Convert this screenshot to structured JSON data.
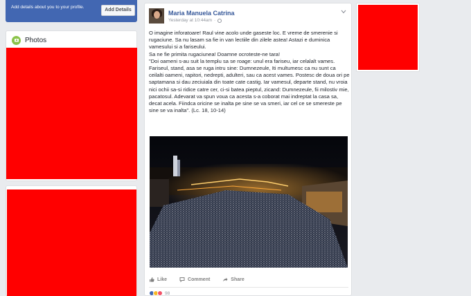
{
  "profile_prompt": {
    "text": "Add details about you to your profile.",
    "button_label": "Add Details"
  },
  "photos": {
    "title": "Photos",
    "icon": "photos-icon"
  },
  "post": {
    "author": "Maria Manuela Catrina",
    "timestamp": "Yesterday at 10:44am",
    "separator": "·",
    "privacy_icon": "globe-icon",
    "paragraphs": [
      "O imagine inforatoare! Raul vine acolo unde gaseste loc. E vreme de smerenie si rugaciune. Sa nu lasam sa fie in van lectiile din zilele astea! Astazi e duminica vamesului si a fariseului.\nSa ne fie primita rugaciunea! Doamne ocroteste-ne tara!\n\"Doi oameni s-au suit la templu sa se roage: unul era fariseu, iar celalalt vames. Fariseul, stand, asa se ruga intru sine: Dumnezeule, Iti multumesc ca nu sunt ca ceilalti oameni, rapitori, nedrepti, adulteri, sau ca acest vames. Postesc de doua ori pe saptamana si dau zeciuiala din toate cate castig. Iar vamesul, departe stand, nu vroia nici ochii sa-si ridice catre cer, ci-si batea pieptul, zicand: Dumnezeule, fii milostiv mie, pacatosul. Adevarat va spun voua ca acesta s-a coborat mai indreptat la casa sa, decat acela. Fiindca oricine se inalta pe sine se va smeri, iar cel ce se smereste pe sine se va inalta\". (Lc. 18, 10-14)"
    ],
    "actions": {
      "like": "Like",
      "comment": "Comment",
      "share": "Share"
    },
    "reaction_count": "98",
    "colors": {
      "link": "#365899",
      "brand": "#4267b2"
    }
  }
}
